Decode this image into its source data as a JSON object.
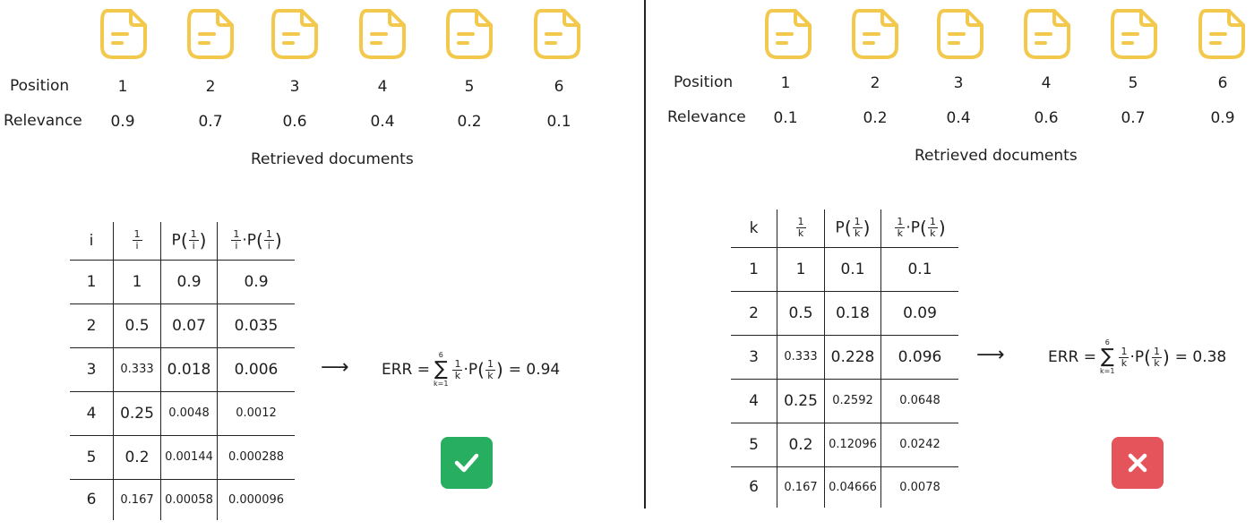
{
  "left": {
    "labels": {
      "position": "Position",
      "relevance": "Relevance",
      "caption": "Retrieved documents"
    },
    "positions": [
      "1",
      "2",
      "3",
      "4",
      "5",
      "6"
    ],
    "relevances": [
      "0.9",
      "0.7",
      "0.6",
      "0.4",
      "0.2",
      "0.1"
    ],
    "table": {
      "header": {
        "col1": "i",
        "var": "i"
      },
      "rows": [
        [
          "1",
          "1",
          "0.9",
          "0.9"
        ],
        [
          "2",
          "0.5",
          "0.07",
          "0.035"
        ],
        [
          "3",
          "0.333",
          "0.018",
          "0.006"
        ],
        [
          "4",
          "0.25",
          "0.0048",
          "0.0012"
        ],
        [
          "5",
          "0.2",
          "0.00144",
          "0.000288"
        ],
        [
          "6",
          "0.167",
          "0.00058",
          "0.000096"
        ]
      ]
    },
    "formula": {
      "prefix": "ERR =",
      "upper": "6",
      "lower": "k=1",
      "result": "= 0.94"
    },
    "arrow": "⟶",
    "badge": {
      "symbol": "✓",
      "color": "#27ae60",
      "status": "correct"
    }
  },
  "right": {
    "labels": {
      "position": "Position",
      "relevance": "Relevance",
      "caption": "Retrieved documents"
    },
    "positions": [
      "1",
      "2",
      "3",
      "4",
      "5",
      "6"
    ],
    "relevances": [
      "0.1",
      "0.2",
      "0.4",
      "0.6",
      "0.7",
      "0.9"
    ],
    "table": {
      "header": {
        "col1": "k",
        "var": "k"
      },
      "rows": [
        [
          "1",
          "1",
          "0.1",
          "0.1"
        ],
        [
          "2",
          "0.5",
          "0.18",
          "0.09"
        ],
        [
          "3",
          "0.333",
          "0.228",
          "0.096"
        ],
        [
          "4",
          "0.25",
          "0.2592",
          "0.0648"
        ],
        [
          "5",
          "0.2",
          "0.12096",
          "0.0242"
        ],
        [
          "6",
          "0.167",
          "0.04666",
          "0.0078"
        ]
      ]
    },
    "formula": {
      "prefix": "ERR =",
      "upper": "6",
      "lower": "k=1",
      "result": "= 0.38"
    },
    "arrow": "⟶",
    "badge": {
      "symbol": "✕",
      "color": "#e5545a",
      "status": "incorrect"
    }
  },
  "common": {
    "one": "1",
    "P": "P",
    "k": "k",
    "dot": "·"
  },
  "colors": {
    "doc_icon": "#f2c94c"
  }
}
